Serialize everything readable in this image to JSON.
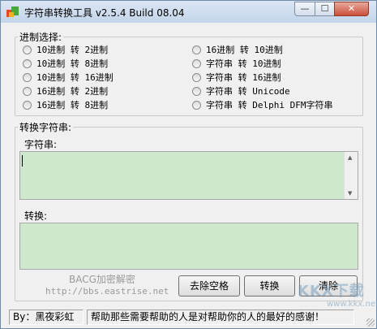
{
  "window": {
    "title": "字符串转换工具 v2.5.4  Build 08.04",
    "min_glyph": "—",
    "max_glyph": "☐",
    "close_glyph": "✕"
  },
  "conversion": {
    "legend": "进制选择:",
    "left_options": [
      {
        "label": "10进制 转 2进制"
      },
      {
        "label": "10进制 转 8进制"
      },
      {
        "label": "10进制 转 16进制"
      },
      {
        "label": "16进制 转 2进制"
      },
      {
        "label": "16进制 转 8进制"
      }
    ],
    "right_options": [
      {
        "label": "16进制 转 10进制"
      },
      {
        "label": "字符串 转 10进制"
      },
      {
        "label": "字符串 转 16进制"
      },
      {
        "label": "字符串 转 Unicode"
      },
      {
        "label": "字符串 转 Delphi DFM字符串"
      }
    ]
  },
  "convert_group": {
    "legend": "转换字符串:",
    "input_label": "字符串:",
    "input_value": "",
    "output_label": "转换:",
    "output_value": ""
  },
  "watermark": {
    "line1": "BACG加密解密",
    "line2": "http://bbs.eastrise.net"
  },
  "buttons": {
    "remove_spaces": "去除空格",
    "convert": "转换",
    "clear": "清除"
  },
  "overlay_logo": {
    "text": "KKX下载",
    "url": "www.kkx.net"
  },
  "status": {
    "author": "By：黑夜彩虹",
    "message": "帮助那些需要帮助的人是对帮助你的人的最好的感谢！"
  },
  "colors": {
    "textbox_bg": "#cde8cd",
    "window_bg": "#f0f0f0"
  }
}
